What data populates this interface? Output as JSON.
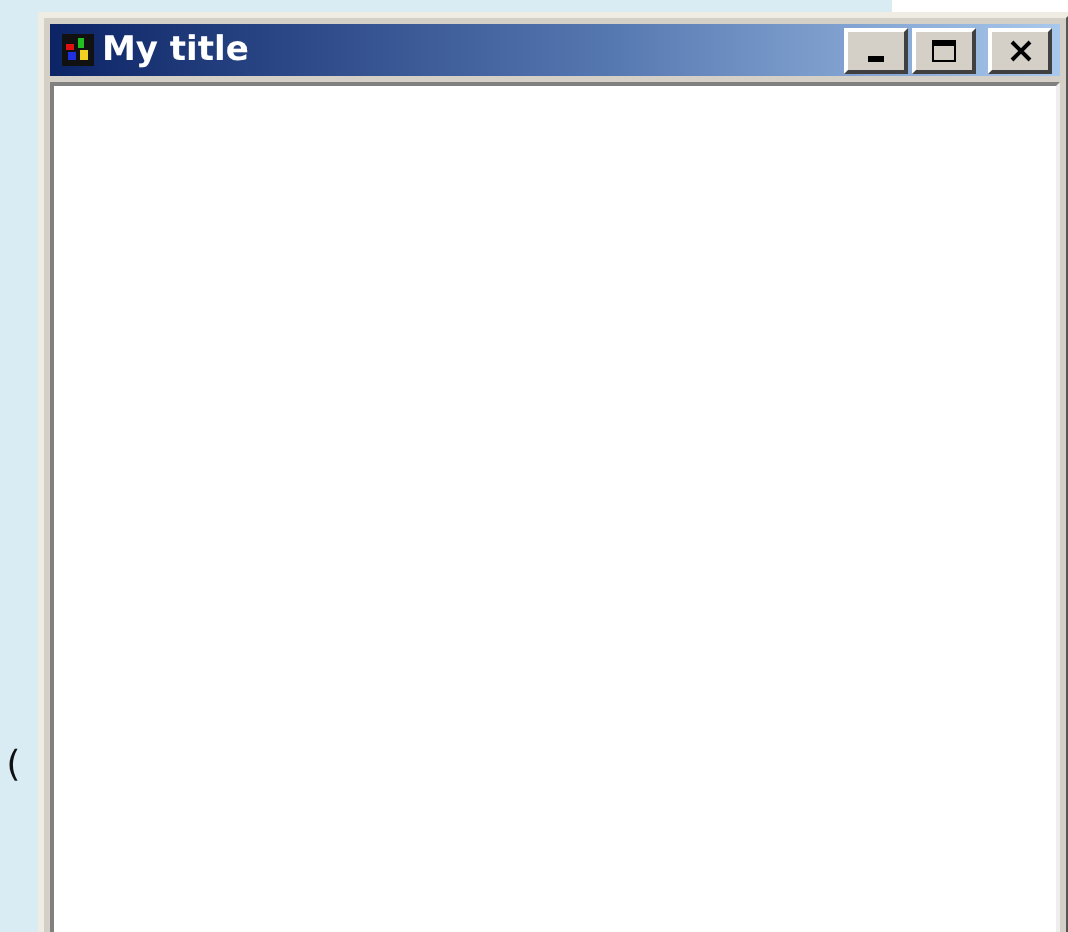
{
  "background_text": "(",
  "window": {
    "title": "My title",
    "buttons": [
      {
        "kind": "minimize"
      },
      {
        "kind": "maximize"
      },
      {
        "kind": "close"
      }
    ]
  }
}
